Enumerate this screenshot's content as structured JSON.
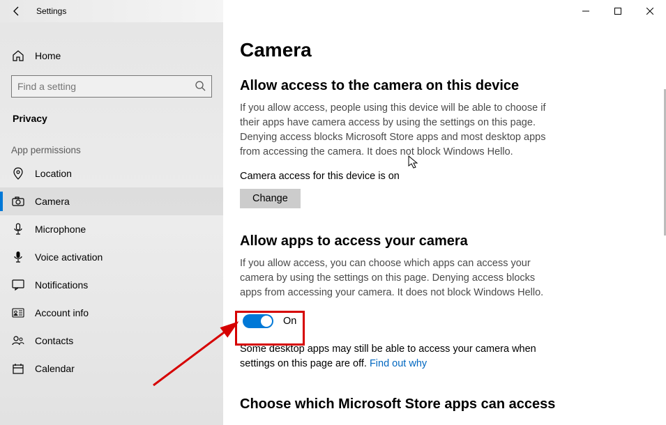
{
  "titlebar": {
    "title": "Settings"
  },
  "sidebar": {
    "home": "Home",
    "search_placeholder": "Find a setting",
    "category": "Privacy",
    "group_label": "App permissions",
    "items": [
      {
        "label": "Location"
      },
      {
        "label": "Camera"
      },
      {
        "label": "Microphone"
      },
      {
        "label": "Voice activation"
      },
      {
        "label": "Notifications"
      },
      {
        "label": "Account info"
      },
      {
        "label": "Contacts"
      },
      {
        "label": "Calendar"
      }
    ]
  },
  "page": {
    "title": "Camera",
    "section1": {
      "heading": "Allow access to the camera on this device",
      "desc": "If you allow access, people using this device will be able to choose if their apps have camera access by using the settings on this page. Denying access blocks Microsoft Store apps and most desktop apps from accessing the camera. It does not block Windows Hello.",
      "status": "Camera access for this device is on",
      "change_btn": "Change"
    },
    "section2": {
      "heading": "Allow apps to access your camera",
      "desc": "If you allow access, you can choose which apps can access your camera by using the settings on this page. Denying access blocks apps from accessing your camera. It does not block Windows Hello.",
      "toggle_state": "On",
      "note_pre": "Some desktop apps may still be able to access your camera when settings on this page are off. ",
      "note_link": "Find out why"
    },
    "section3": {
      "heading": "Choose which Microsoft Store apps can access"
    }
  }
}
